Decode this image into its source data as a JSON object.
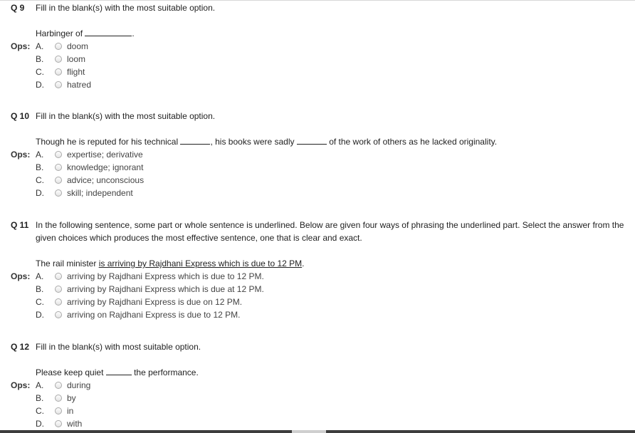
{
  "ops_label": "Ops:",
  "questions": [
    {
      "number": "Q 9",
      "prompt": "Fill in the blank(s) with the most suitable option.",
      "stem_parts": [
        "Harbinger of ",
        "."
      ],
      "options": [
        {
          "letter": "A.",
          "text": "doom"
        },
        {
          "letter": "B.",
          "text": "loom"
        },
        {
          "letter": "C.",
          "text": "flight"
        },
        {
          "letter": "D.",
          "text": "hatred"
        }
      ]
    },
    {
      "number": "Q 10",
      "prompt": "Fill in the blank(s) with the most suitable option.",
      "stem_parts": [
        "Though he is reputed for his technical ",
        ", his books were sadly ",
        " of the work of others as he lacked originality."
      ],
      "options": [
        {
          "letter": "A.",
          "text": "expertise; derivative"
        },
        {
          "letter": "B.",
          "text": "knowledge; ignorant"
        },
        {
          "letter": "C.",
          "text": "advice; unconscious"
        },
        {
          "letter": "D.",
          "text": "skill; independent"
        }
      ]
    },
    {
      "number": "Q 11",
      "prompt_line1": "In the following sentence, some part or whole sentence is underlined. Below are given four ways of phrasing the underlined part. Select the answer from the",
      "prompt_line2": "given choices which produces the most effective sentence, one that is clear and exact.",
      "stem_plain": "The rail minister ",
      "stem_underlined": "is arriving by Rajdhani Express which is due to 12 PM",
      "stem_end": ".",
      "options": [
        {
          "letter": "A.",
          "text": "arriving by Rajdhani Express which is due to 12 PM."
        },
        {
          "letter": "B.",
          "text": "arriving by Rajdhani Express which is due at 12 PM."
        },
        {
          "letter": "C.",
          "text": "arriving by Rajdhani Express is due on 12 PM."
        },
        {
          "letter": "D.",
          "text": "arriving on Rajdhani Express is due to 12 PM."
        }
      ]
    },
    {
      "number": "Q 12",
      "prompt": "Fill in the blank(s) with most suitable option.",
      "stem_parts": [
        "Please keep quiet ",
        " the performance."
      ],
      "options": [
        {
          "letter": "A.",
          "text": "during"
        },
        {
          "letter": "B.",
          "text": "by"
        },
        {
          "letter": "C.",
          "text": "in"
        },
        {
          "letter": "D.",
          "text": "with"
        }
      ]
    }
  ]
}
